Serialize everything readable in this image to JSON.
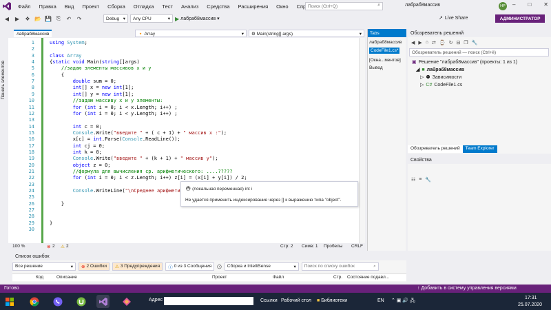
{
  "menu": [
    "Файл",
    "Правка",
    "Вид",
    "Проект",
    "Сборка",
    "Отладка",
    "Тест",
    "Анализ",
    "Средства",
    "Расширения",
    "Окно",
    "Справка"
  ],
  "search_placeholder": "Поиск (Ctrl+Q)",
  "solution_title": "лабраб8массив",
  "avatar_initials": "НР",
  "toolbar": {
    "config": "Debug",
    "platform": "Any CPU",
    "run_label": "лабраб8массив",
    "liveshare": "Live Share",
    "admin": "АДМИНИСТРАТОР"
  },
  "left_tab": "Панель элементов",
  "editor": {
    "doc_tab": "лабраб8массив",
    "nav_class": "Array",
    "nav_member": "Main(string[] args)",
    "code_lines": [
      {
        "n": "1",
        "t": "using System;"
      },
      {
        "n": "2",
        "t": ""
      },
      {
        "n": "3",
        "t": "class Array"
      },
      {
        "n": "4",
        "t": "{static void Main(string[]args)"
      },
      {
        "n": "5",
        "t": "    //задаю элементы массивов x и y"
      },
      {
        "n": "6",
        "t": "    {"
      },
      {
        "n": "7",
        "t": "        double sum = 0;"
      },
      {
        "n": "8",
        "t": "        int[] x = new int[1];"
      },
      {
        "n": "9",
        "t": "        int[] y = new int[1];"
      },
      {
        "n": "10",
        "t": "        //задаю массиву x и y элементы:"
      },
      {
        "n": "11",
        "t": "        for (int i = 0; i < x.Length; i++) ;"
      },
      {
        "n": "12",
        "t": "        for (int i = 0; i < y.Length; i++) ;"
      },
      {
        "n": "13",
        "t": ""
      },
      {
        "n": "14",
        "t": "        int c = 0;"
      },
      {
        "n": "15",
        "t": "        Console.Write(\"введите \" + ( c + 1) + \" массив x :\");"
      },
      {
        "n": "16",
        "t": "        x[c] = int.Parse(Console.ReadLine());"
      },
      {
        "n": "17",
        "t": "        int cj = 0;"
      },
      {
        "n": "18",
        "t": "        int k = 0;"
      },
      {
        "n": "19",
        "t": "        Console.Write(\"введите \" + (k + 1) + \" массив y\");"
      },
      {
        "n": "20",
        "t": "        object z = 0;"
      },
      {
        "n": "21",
        "t": "        //формула для вычисления ср. арифметического: ....?????"
      },
      {
        "n": "22",
        "t": "        for (int i = 0; i < z.Length; i++) z[i] = (x[i] + y[i]) / 2;"
      },
      {
        "n": "23",
        "t": ""
      },
      {
        "n": "24",
        "t": "        Console.WriteLine(\"\\nСреднее арифмети"
      },
      {
        "n": "25",
        "t": ""
      },
      {
        "n": "26",
        "t": "    }"
      },
      {
        "n": "27",
        "t": ""
      },
      {
        "n": "28",
        "t": ""
      },
      {
        "n": "29",
        "t": "}"
      },
      {
        "n": "30",
        "t": ""
      }
    ],
    "tooltip_line1": "(локальная переменная) int i",
    "tooltip_line2": "Не удается применить индексирование через [] к выражению типа \"object\"."
  },
  "editor_status": {
    "zoom": "100 %",
    "errors": "2",
    "warnings": "2",
    "line": "Стр: 2",
    "col": "Симв: 1",
    "spaces": "Пробелы",
    "eol": "CRLF"
  },
  "tabs_panel": {
    "title": "Tabs",
    "items": [
      "лабраб8массив",
      "CodeFile1.cs*",
      "[Окна...ментов]",
      "Вывод"
    ]
  },
  "solution_explorer": {
    "title": "Обозреватель решений",
    "search_placeholder": "Обозреватель решений — поиск (Ctrl+ё)",
    "tree": [
      {
        "label": "Решение \"лабраб8массив\" (проекты: 1 из 1)",
        "level": 0
      },
      {
        "label": "лабраб8массив",
        "level": 1
      },
      {
        "label": "Зависимости",
        "level": 2
      },
      {
        "label": "CodeFile1.cs",
        "level": 2
      }
    ],
    "tabs": [
      "Обозреватель решений",
      "Team Explorer"
    ]
  },
  "properties": {
    "title": "Свойства"
  },
  "error_list": {
    "title": "Список ошибок",
    "scope": "Все решение",
    "errors": "2 Ошибки",
    "warnings": "3 Предупреждения",
    "messages": "0 из 3 Сообщения",
    "build_filter": "Сборка и IntelliSense",
    "search_placeholder": "Поиск по списку ошибок",
    "columns": [
      "Код",
      "Описание",
      "Проект",
      "Файл",
      "Стр.",
      "Состояние подавл..."
    ]
  },
  "statusbar": {
    "left": "Готово",
    "right": "Добавить в систему управления версиями"
  },
  "taskbar": {
    "address_label": "Адрес",
    "links": "Ссылки",
    "desktop": "Рабочий стол",
    "libraries": "Библиотеки",
    "lang": "EN",
    "time": "17:31",
    "date": "25.07.2020"
  },
  "colors": {
    "vs_purple": "#68217a",
    "accent_blue": "#007acc",
    "keyword": "#0000ff",
    "type": "#2b91af",
    "string": "#a31515",
    "comment": "#008000"
  }
}
